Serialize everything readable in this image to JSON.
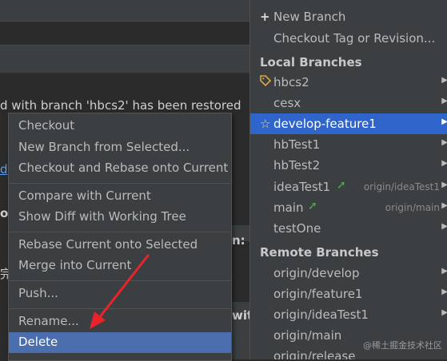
{
  "background": {
    "restored_message": "d with branch 'hbcs2' has been restored",
    "fragment_right": "n: h",
    "fragment_wit": "wit",
    "fragment_link": "d",
    "fragment_bold": "o",
    "fragment_cjk": "完"
  },
  "branches_popup": {
    "new_branch": "New Branch",
    "checkout_tag": "Checkout Tag or Revision...",
    "local_header": "Local Branches",
    "local": [
      {
        "name": "hbcs2",
        "icon": "tag-icon",
        "tracking": ""
      },
      {
        "name": "cesx",
        "icon": "",
        "tracking": ""
      },
      {
        "name": "develop-feature1",
        "icon": "star-icon",
        "tracking": ""
      },
      {
        "name": "hbTest1",
        "icon": "",
        "tracking": ""
      },
      {
        "name": "hbTest2",
        "icon": "",
        "tracking": ""
      },
      {
        "name": "ideaTest1",
        "icon": "",
        "tracking": "origin/ideaTest1"
      },
      {
        "name": "main",
        "icon": "",
        "tracking": "origin/main"
      },
      {
        "name": "testOne",
        "icon": "",
        "tracking": ""
      }
    ],
    "remote_header": "Remote Branches",
    "remote": [
      "origin/develop",
      "origin/feature1",
      "origin/ideaTest1",
      "origin/main",
      "origin/release"
    ]
  },
  "context_menu": {
    "items": [
      "Checkout",
      "New Branch from Selected...",
      "Checkout and Rebase onto Current",
      "Compare with Current",
      "Show Diff with Working Tree",
      "Rebase Current onto Selected",
      "Merge into Current",
      "Push...",
      "Rename...",
      "Delete"
    ],
    "selected": "Delete"
  },
  "watermark": "@稀土掘金技术社区",
  "colors": {
    "selection": "#2f65ca",
    "menu_selection": "#4b6eaf",
    "outgoing_arrow": "#4caf50",
    "annotation_arrow": "#e8242a"
  }
}
